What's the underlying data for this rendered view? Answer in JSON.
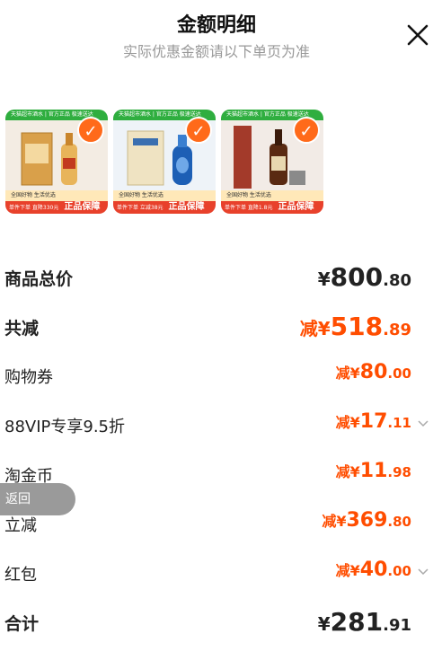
{
  "header": {
    "title": "金额明细",
    "subtitle": "实际优惠金额请以下单页为准"
  },
  "products": [
    {
      "topbar": "天猫超市酒水 | 官方正品 极速送达",
      "strip": "全国好物 生活优选",
      "bottom_text": "单件下单 直降330元",
      "bottom_badge": "正品保障"
    },
    {
      "topbar": "天猫超市酒水 | 官方正品 极速送达",
      "strip": "全国好物 生活优选",
      "bottom_text": "单件下单 立减38元",
      "bottom_badge": "正品保障"
    },
    {
      "topbar": "天猫超市酒水 | 官方正品 极速送达",
      "strip": "全国好物 生活优选",
      "bottom_text": "单件下单 直降1.8元",
      "bottom_badge": "正品保障"
    }
  ],
  "check_glyph": "✓",
  "rows": {
    "total_price": {
      "label": "商品总价",
      "prefix": "",
      "cur": "¥",
      "int": "800",
      "dec": ".80"
    },
    "total_reduce": {
      "label": "共减",
      "prefix": "减",
      "cur": "¥",
      "int": "518",
      "dec": ".89"
    },
    "coupon": {
      "label": "购物券",
      "prefix": "减",
      "cur": "¥",
      "int": "80",
      "dec": ".00"
    },
    "vip": {
      "label": "88VIP专享9.5折",
      "prefix": "减",
      "cur": "¥",
      "int": "17",
      "dec": ".11"
    },
    "taojinbi": {
      "label": "淘金币",
      "prefix": "减",
      "cur": "¥",
      "int": "11",
      "dec": ".98"
    },
    "instant": {
      "label": "立减",
      "prefix": "减",
      "cur": "¥",
      "int": "369",
      "dec": ".80"
    },
    "redpacket": {
      "label": "红包",
      "prefix": "减",
      "cur": "¥",
      "int": "40",
      "dec": ".00"
    },
    "sum": {
      "label": "合计",
      "prefix": "",
      "cur": "¥",
      "int": "281",
      "dec": ".91"
    }
  },
  "back_pill": "返回",
  "colors": {
    "accent": "#ff4d00",
    "check": "#ff6a1a",
    "green_bar": "#2fae3f",
    "red_bar": "#e8412b"
  }
}
